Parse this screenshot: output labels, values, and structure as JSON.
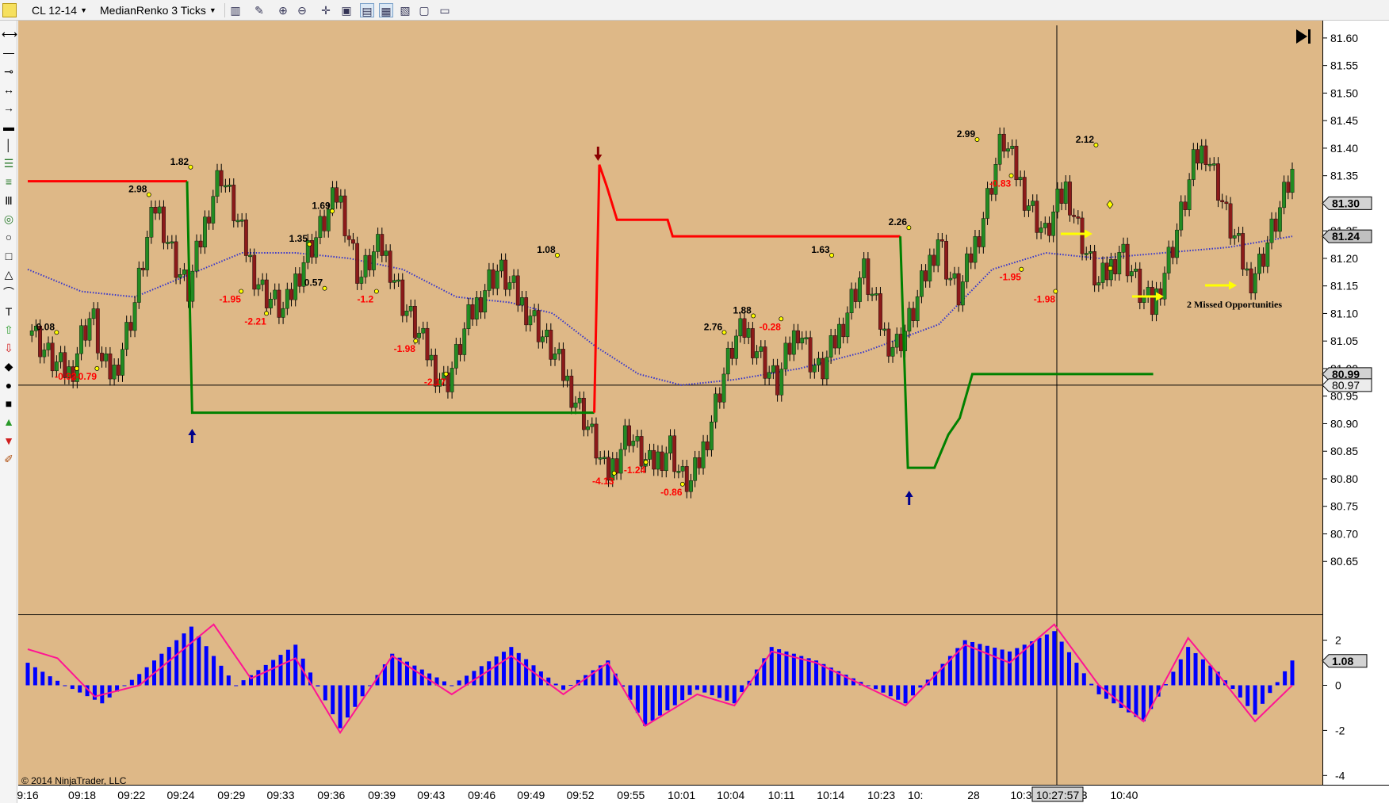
{
  "toolbar": {
    "instrument": "CL 12-14",
    "bar_type": "MedianRenko 3 Ticks",
    "icons": [
      "chart-style-icon",
      "draw-pencil-icon",
      "zoom-in-icon",
      "zoom-out-icon",
      "crosshair-icon",
      "data-box-icon",
      "strategies-icon",
      "indicators-icon",
      "chart-properties-icon",
      "new-tab-icon",
      "panel-icon"
    ]
  },
  "left_tools": [
    "ruler-icon",
    "line-icon",
    "ray-icon",
    "extended-line-icon",
    "arrow-line-icon",
    "horizontal-line-icon",
    "vertical-line-icon",
    "fibonacci-retracement-icon",
    "fibonacci-extension-icon",
    "fibonacci-timezone-icon",
    "fibonacci-circle-icon",
    "ellipse-icon",
    "rectangle-icon",
    "triangle-icon",
    "arc-icon",
    "text-icon",
    "arrow-up-icon",
    "arrow-down-icon",
    "diamond-icon",
    "dot-icon",
    "square-icon",
    "triangle-up-icon",
    "triangle-down-icon",
    "remove-drawings-icon"
  ],
  "colors": {
    "chart_background": "#DEB887",
    "up_bar": "#228B22",
    "down_bar": "#8B1A1A",
    "stop_line_short": "#FF0000",
    "stop_line_long": "#008000",
    "moving_average": "#3333CC",
    "histogram": "#0000FF",
    "signal_line": "#FF1493",
    "swing_high_label": "#000000",
    "swing_low_label": "#FF0000",
    "marker_arrow": "#FFFF00",
    "signal_arrow_up": "#00008B",
    "signal_arrow_down": "#8B0000"
  },
  "axis": {
    "price_ticks": [
      "81.60",
      "81.55",
      "81.50",
      "81.45",
      "81.40",
      "81.35",
      "81.30",
      "81.25",
      "81.20",
      "81.15",
      "81.10",
      "81.05",
      "81.00",
      "80.95",
      "80.90",
      "80.85",
      "80.80",
      "80.75",
      "80.70",
      "80.65"
    ],
    "price_badges": [
      "81.30",
      "81.24",
      "80.99",
      "80.97"
    ],
    "indicator_ticks": [
      "2",
      "0",
      "-2",
      "-4"
    ],
    "indicator_badge": "1.08",
    "time_ticks": [
      "9:16",
      "09:18",
      "09:22",
      "09:24",
      "09:29",
      "09:33",
      "09:36",
      "09:39",
      "09:43",
      "09:46",
      "09:49",
      "09:52",
      "09:55",
      "10:01",
      "10:04",
      "10:11",
      "10:14",
      "10:23",
      "10:",
      "28",
      "10:31",
      "10:33",
      "10:40"
    ],
    "crosshair_time": "10:27:57"
  },
  "swing_labels": [
    {
      "text": "0.08",
      "kind": "high"
    },
    {
      "text": "-0.92",
      "kind": "low"
    },
    {
      "text": "-0.79",
      "kind": "low"
    },
    {
      "text": "2.98",
      "kind": "high"
    },
    {
      "text": "1.82",
      "kind": "high"
    },
    {
      "text": "-1.95",
      "kind": "low"
    },
    {
      "text": "-2.21",
      "kind": "low"
    },
    {
      "text": "1.35",
      "kind": "high"
    },
    {
      "text": "0.57",
      "kind": "high"
    },
    {
      "text": "1.69",
      "kind": "high"
    },
    {
      "text": "-1.2",
      "kind": "low"
    },
    {
      "text": "-1.98",
      "kind": "low"
    },
    {
      "text": "-2.17",
      "kind": "low"
    },
    {
      "text": "1.08",
      "kind": "high"
    },
    {
      "text": "-4.13",
      "kind": "low"
    },
    {
      "text": "-1.24",
      "kind": "low"
    },
    {
      "text": "-0.86",
      "kind": "low"
    },
    {
      "text": "2.76",
      "kind": "high"
    },
    {
      "text": "1.88",
      "kind": "high"
    },
    {
      "text": "-0.28",
      "kind": "low"
    },
    {
      "text": "1.63",
      "kind": "high"
    },
    {
      "text": "2.26",
      "kind": "high"
    },
    {
      "text": "2.99",
      "kind": "high"
    },
    {
      "text": "-0.83",
      "kind": "low"
    },
    {
      "text": "-1.95",
      "kind": "low"
    },
    {
      "text": "-1.98",
      "kind": "low"
    },
    {
      "text": "2.12",
      "kind": "high"
    }
  ],
  "annotation": "2 Missed Opportunities",
  "copyright": "© 2014 NinjaTrader, LLC",
  "chart_data": {
    "type": "candlestick",
    "instrument": "CL 12-14",
    "bar_type": "MedianRenko 3 Ticks",
    "ylim": [
      80.6,
      81.62
    ],
    "price_path": [
      81.09,
      81.05,
      81.02,
      81.0,
      80.99,
      81.06,
      81.1,
      81.0,
      80.99,
      81.05,
      81.12,
      81.22,
      81.3,
      81.24,
      81.18,
      81.14,
      81.22,
      81.3,
      81.36,
      81.3,
      81.24,
      81.18,
      81.14,
      81.12,
      81.1,
      81.16,
      81.21,
      81.24,
      81.28,
      81.32,
      81.24,
      81.16,
      81.2,
      81.22,
      81.18,
      81.12,
      81.08,
      81.04,
      81.0,
      80.97,
      81.02,
      81.08,
      81.12,
      81.16,
      81.18,
      81.15,
      81.12,
      81.1,
      81.06,
      81.03,
      80.99,
      80.95,
      80.91,
      80.86,
      80.8,
      80.84,
      80.89,
      80.85,
      80.82,
      80.84,
      80.86,
      80.8,
      80.79,
      80.85,
      80.92,
      80.99,
      81.05,
      81.07,
      81.04,
      81.0,
      80.97,
      81.03,
      81.08,
      81.02,
      80.99,
      81.03,
      81.08,
      81.13,
      81.18,
      81.12,
      81.06,
      81.04,
      81.07,
      81.12,
      81.18,
      81.24,
      81.17,
      81.13,
      81.2,
      81.26,
      81.34,
      81.42,
      81.37,
      81.32,
      81.28,
      81.24,
      81.29,
      81.33,
      81.26,
      81.2,
      81.15,
      81.18,
      81.22,
      81.18,
      81.13,
      81.11,
      81.17,
      81.23,
      81.3,
      81.38,
      81.4,
      81.34,
      81.27,
      81.22,
      81.16,
      81.19,
      81.24,
      81.29,
      81.35
    ],
    "moving_average": [
      [
        0,
        81.18
      ],
      [
        5,
        81.14
      ],
      [
        10,
        81.13
      ],
      [
        15,
        81.17
      ],
      [
        20,
        81.21
      ],
      [
        25,
        81.21
      ],
      [
        30,
        81.2
      ],
      [
        35,
        81.18
      ],
      [
        40,
        81.13
      ],
      [
        45,
        81.12
      ],
      [
        49,
        81.1
      ],
      [
        53,
        81.04
      ],
      [
        57,
        80.99
      ],
      [
        61,
        80.97
      ],
      [
        66,
        80.98
      ],
      [
        72,
        81.0
      ],
      [
        78,
        81.03
      ],
      [
        85,
        81.08
      ],
      [
        90,
        81.18
      ],
      [
        95,
        81.21
      ],
      [
        100,
        81.2
      ],
      [
        106,
        81.21
      ],
      [
        112,
        81.22
      ],
      [
        118,
        81.24
      ]
    ],
    "stop_line_short": [
      [
        81.34,
        "09:16-09:24"
      ],
      [
        81.37,
        "09:53"
      ],
      [
        81.27,
        "09:55"
      ],
      [
        81.24,
        "09:58-10:25"
      ]
    ],
    "stop_line_long": [
      [
        80.92,
        "09:25-09:53"
      ],
      [
        80.82,
        "10:26"
      ],
      [
        80.99,
        "10:28-10:42"
      ]
    ],
    "indicator": {
      "ylim": [
        -4.2,
        2.9
      ],
      "histogram_keypoints": [
        [
          0,
          1.0
        ],
        [
          5,
          0.0
        ],
        [
          10,
          -0.8
        ],
        [
          15,
          0.5
        ],
        [
          22,
          2.6
        ],
        [
          28,
          0.0
        ],
        [
          36,
          1.8
        ],
        [
          42,
          -1.9
        ],
        [
          49,
          1.4
        ],
        [
          57,
          0.0
        ],
        [
          65,
          1.7
        ],
        [
          72,
          -0.2
        ],
        [
          78,
          1.1
        ],
        [
          83,
          -1.8
        ],
        [
          90,
          -0.2
        ],
        [
          95,
          -0.8
        ],
        [
          100,
          1.7
        ],
        [
          106,
          1.1
        ],
        [
          118,
          -0.8
        ],
        [
          126,
          2.0
        ],
        [
          132,
          1.5
        ],
        [
          138,
          2.4
        ],
        [
          144,
          -0.4
        ],
        [
          150,
          -1.6
        ],
        [
          156,
          1.7
        ],
        [
          160,
          0.6
        ],
        [
          165,
          -1.3
        ],
        [
          170,
          1.1
        ]
      ],
      "signal_keypoints": [
        [
          0,
          1.6
        ],
        [
          4,
          1.2
        ],
        [
          9,
          -0.5
        ],
        [
          15,
          0.0
        ],
        [
          25,
          2.7
        ],
        [
          30,
          0.3
        ],
        [
          36,
          1.2
        ],
        [
          42,
          -2.1
        ],
        [
          49,
          1.3
        ],
        [
          57,
          -0.4
        ],
        [
          65,
          1.3
        ],
        [
          72,
          -0.4
        ],
        [
          78,
          1.0
        ],
        [
          83,
          -1.8
        ],
        [
          90,
          -0.4
        ],
        [
          95,
          -0.9
        ],
        [
          100,
          1.5
        ],
        [
          106,
          1.0
        ],
        [
          118,
          -0.9
        ],
        [
          126,
          1.8
        ],
        [
          132,
          1.0
        ],
        [
          138,
          2.7
        ],
        [
          144,
          0.0
        ],
        [
          150,
          -1.6
        ],
        [
          156,
          2.1
        ],
        [
          160,
          0.5
        ],
        [
          165,
          -1.6
        ],
        [
          170,
          0.0
        ]
      ],
      "current_value": 1.08
    }
  }
}
